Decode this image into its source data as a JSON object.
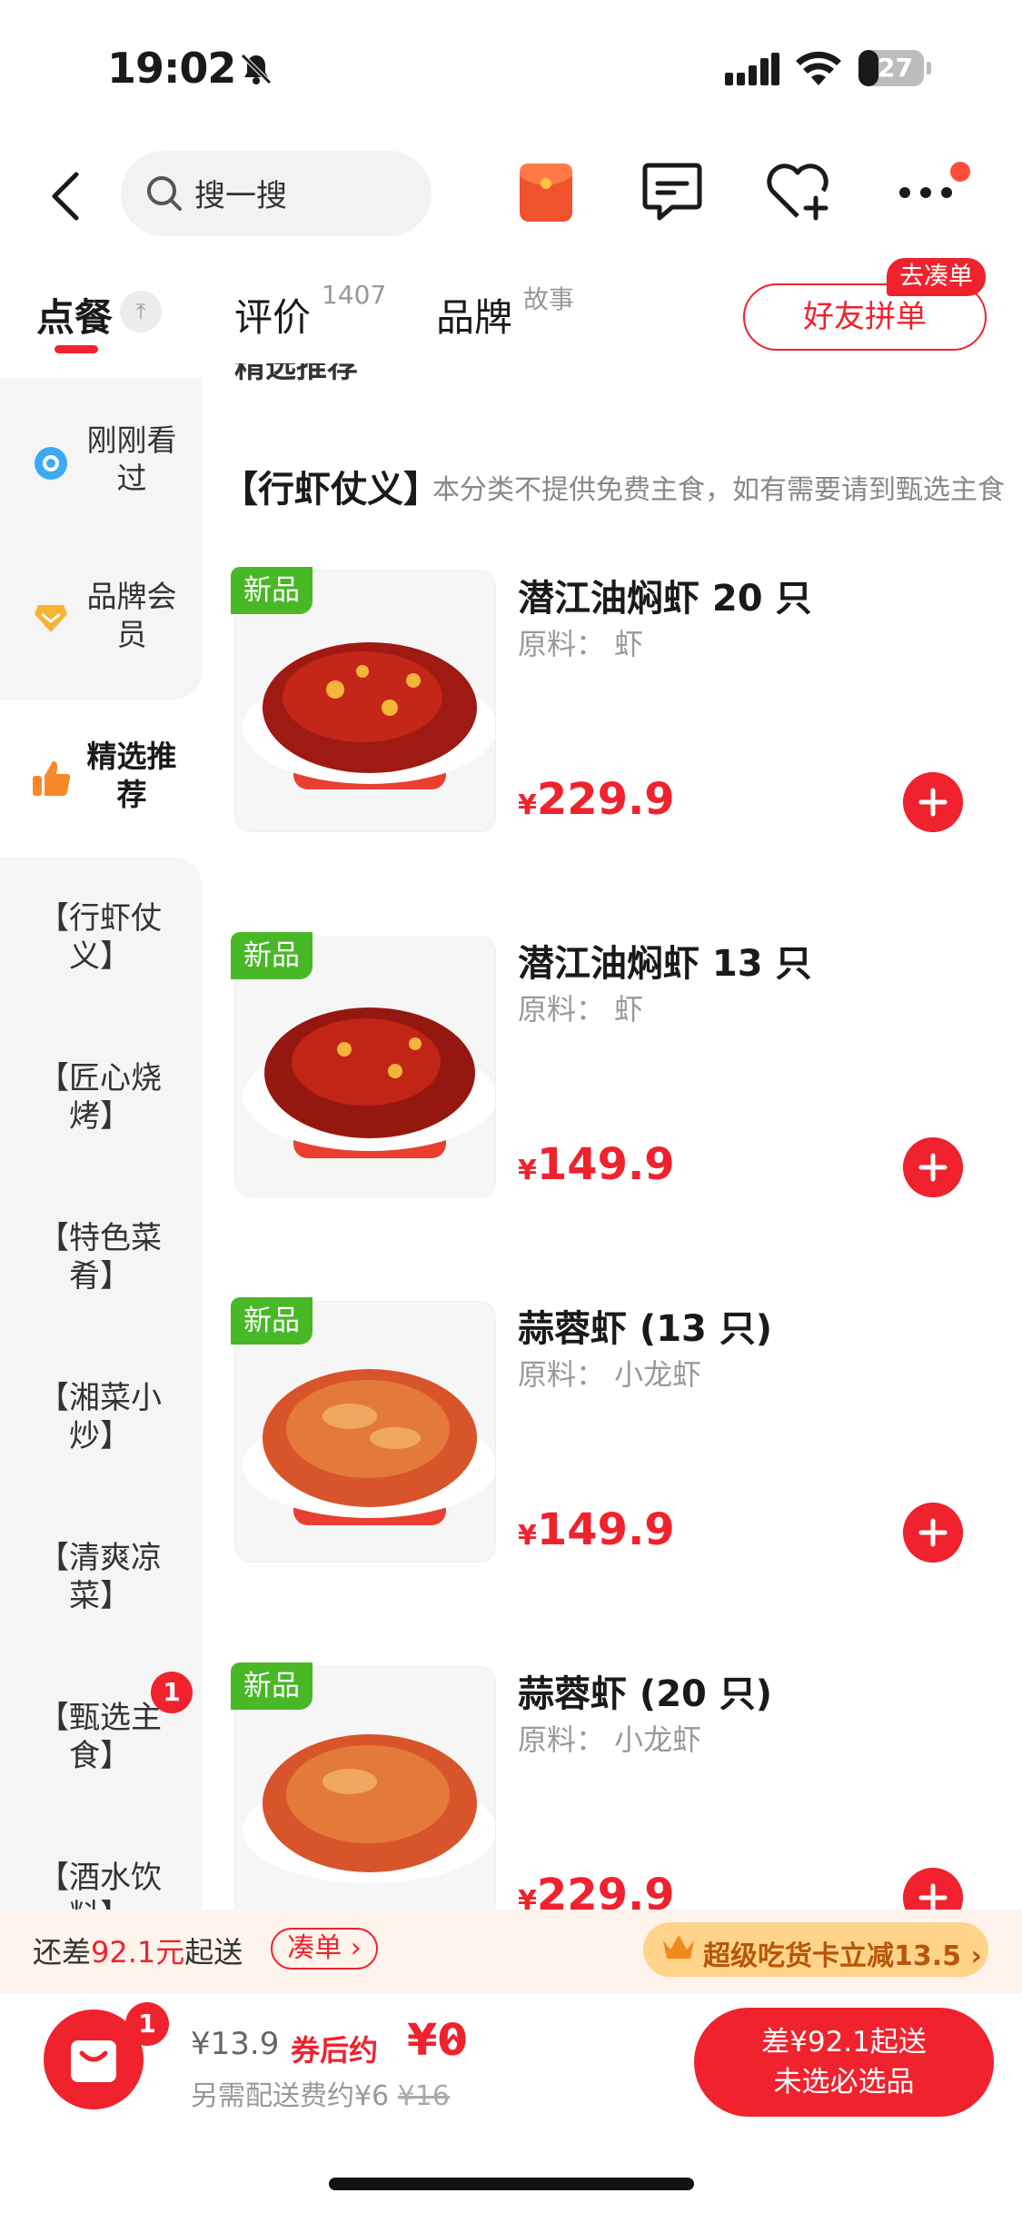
{
  "status": {
    "time": "19:02",
    "battery": "27"
  },
  "header": {
    "search_placeholder": "搜一搜"
  },
  "tabs": {
    "order": "点餐",
    "review": "评价",
    "review_count": "1407",
    "brand": "品牌",
    "brand_sup": "故事",
    "group_order": "好友拼单",
    "go_tag": "去凑单"
  },
  "sidebar": {
    "recent": "刚刚看过",
    "member": "品牌会员",
    "featured": "精选推荐",
    "categories": [
      "【行虾仗义】",
      "【匠心烧烤】",
      "【特色菜肴】",
      "【湘菜小炒】",
      "【清爽凉菜】",
      "【甄选主食】",
      "【酒水饮料】"
    ],
    "staple_badge": "1"
  },
  "content": {
    "cut_title": "精选推荐",
    "section_title": "【行虾仗义】",
    "section_note": "本分类不提供免费主食，如有需要请到甄选主食",
    "new_tag": "新品",
    "currency": "¥",
    "products": [
      {
        "name": "潜江油焖虾 20 只",
        "material": "原料：  虾",
        "price": "229.9"
      },
      {
        "name": "潜江油焖虾 13 只",
        "material": "原料：  虾",
        "price": "149.9"
      },
      {
        "name": "蒜蓉虾 (13 只)",
        "material": "原料：  小龙虾",
        "price": "149.9"
      },
      {
        "name": "蒜蓉虾 (20 只)",
        "material": "原料：  小龙虾",
        "price": "229.9"
      }
    ]
  },
  "tipbar": {
    "prefix": "还差",
    "amount": "92.1元",
    "suffix": "起送",
    "add_button": "凑单",
    "vip_text": "超级吃货卡立减13.5"
  },
  "bottom": {
    "cart_badge": "1",
    "original_price": "¥13.9",
    "after_coupon": "券后约",
    "after_value": "¥0",
    "fee_text": "另需配送费约¥6",
    "fee_strike": "¥16",
    "checkout_line1": "差¥92.1起送",
    "checkout_line2": "未选必选品"
  },
  "colors": {
    "accent": "#f0222d",
    "new_tag": "#49b826"
  }
}
